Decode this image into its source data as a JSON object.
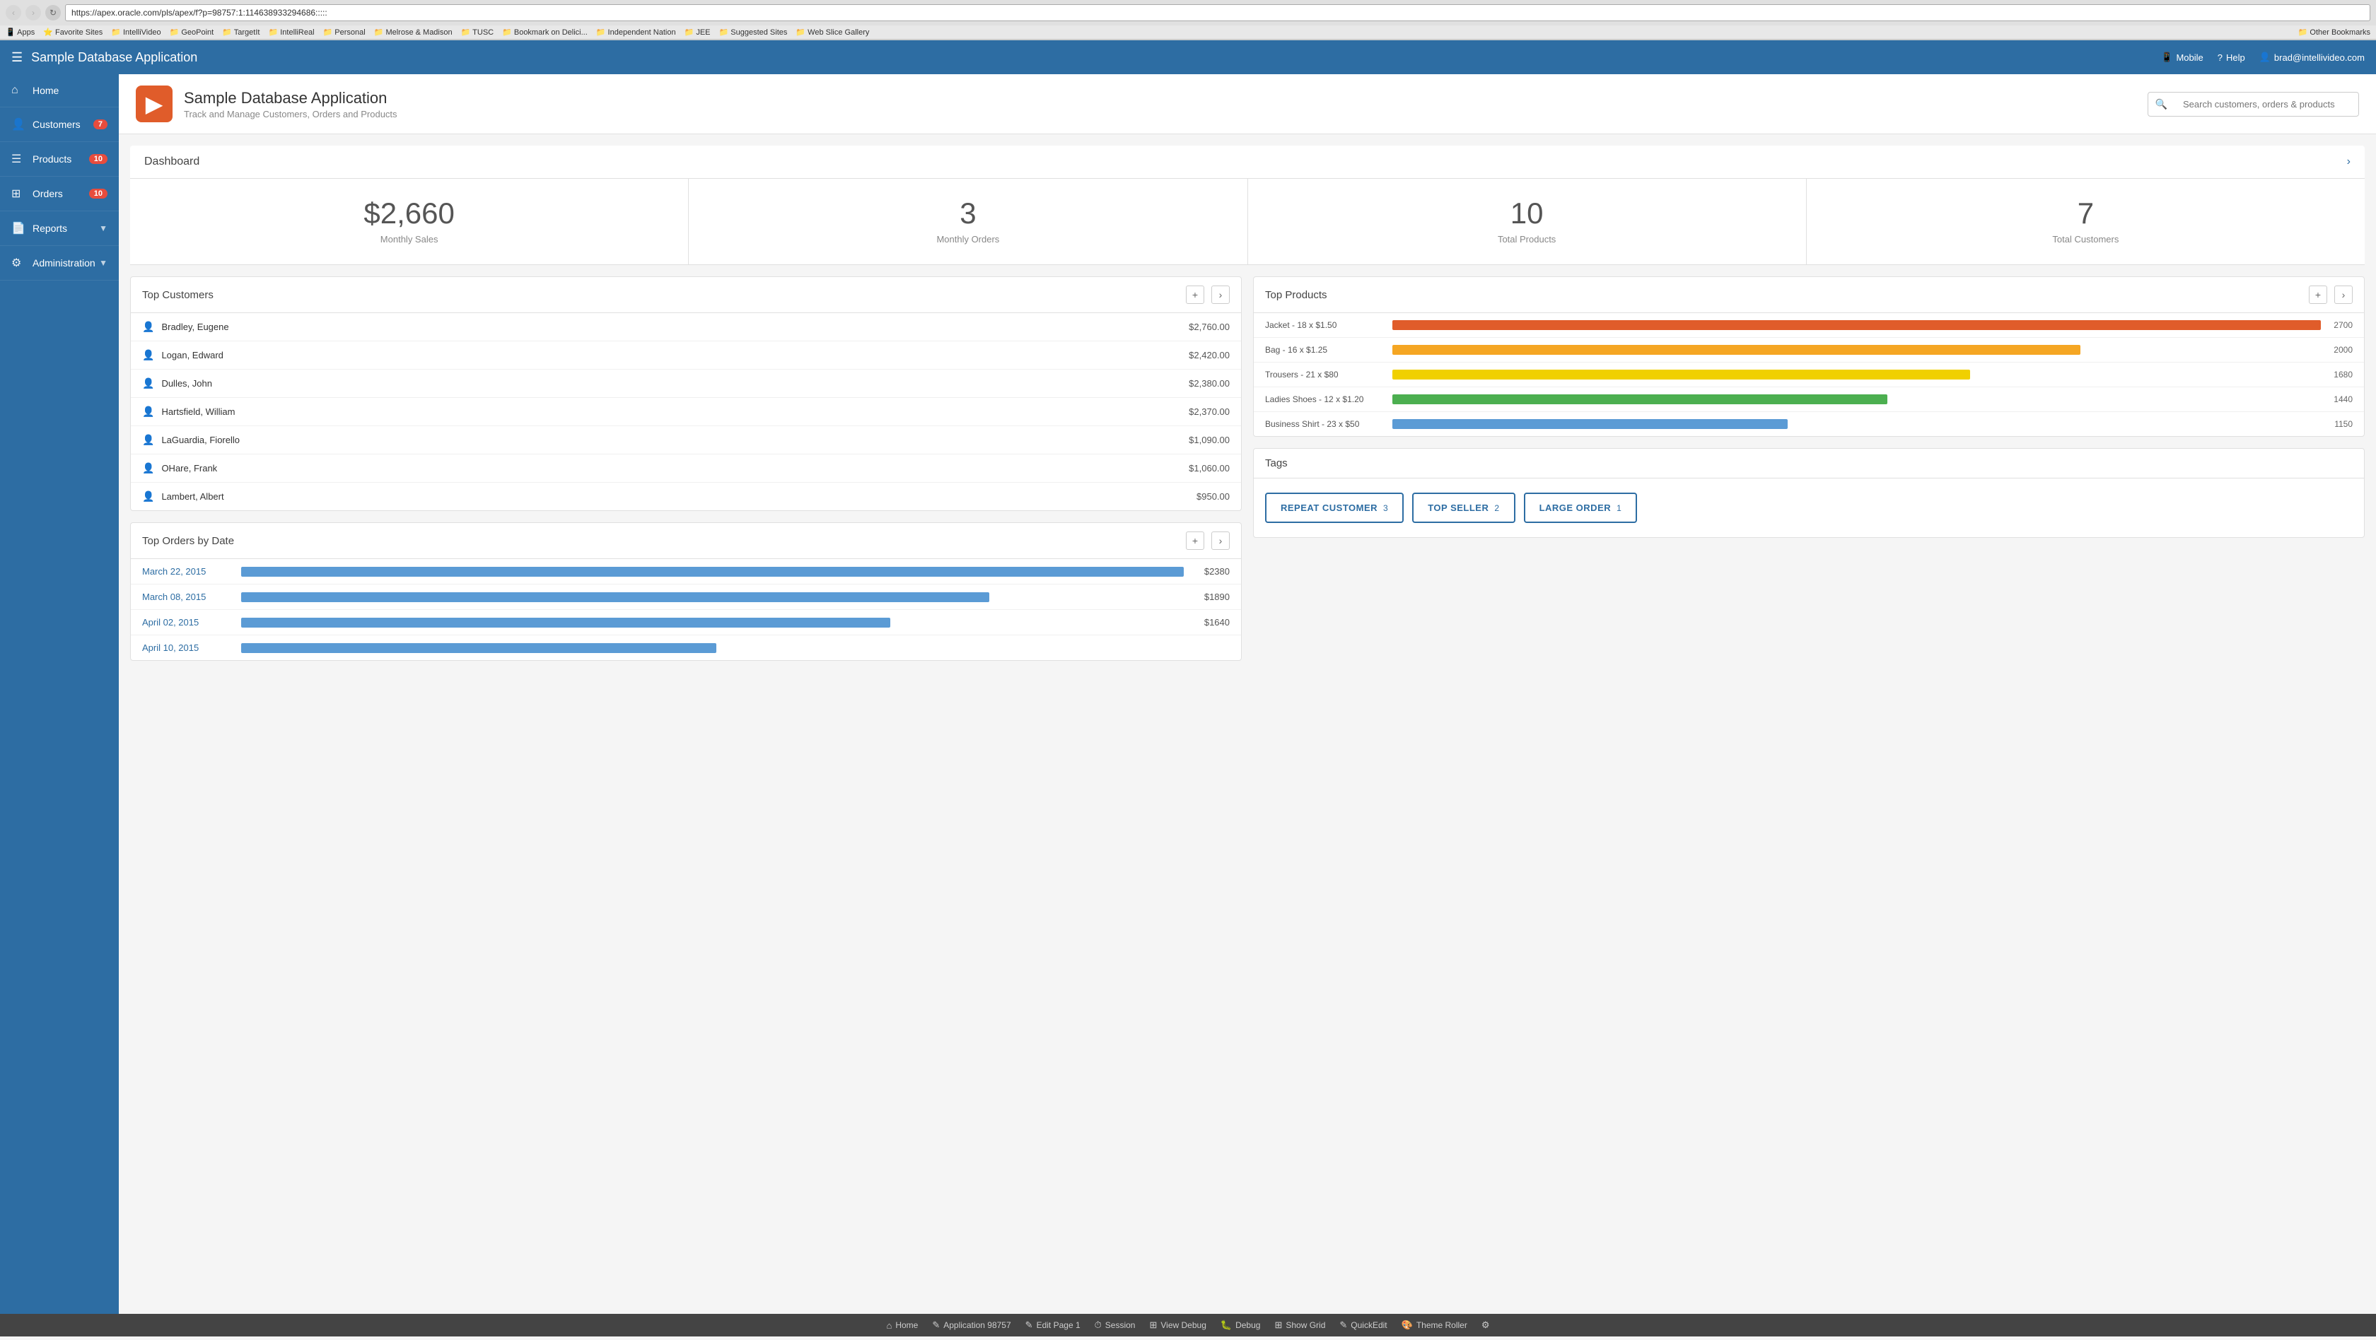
{
  "browser": {
    "url": "https://apex.oracle.com/pls/apex/f?p=98757:1:114638933294686:::::",
    "bookmarks": [
      "Apps",
      "Favorite Sites",
      "IntelliVideo",
      "GeoPoint",
      "TargetIt",
      "IntelliReal",
      "Personal",
      "Melrose & Madison",
      "TUSC",
      "Bookmark on Delici...",
      "Independent Nation",
      "JEE",
      "Suggested Sites",
      "Web Slice Gallery",
      "Other Bookmarks"
    ]
  },
  "topnav": {
    "title": "Sample Database Application",
    "mobile_label": "Mobile",
    "help_label": "Help",
    "user_label": "brad@intellivideo.com"
  },
  "sidebar": {
    "items": [
      {
        "id": "home",
        "label": "Home",
        "icon": "⌂",
        "badge": null,
        "chevron": false,
        "active": false
      },
      {
        "id": "customers",
        "label": "Customers",
        "icon": "👤",
        "badge": "7",
        "chevron": false,
        "active": false
      },
      {
        "id": "products",
        "label": "Products",
        "icon": "☰",
        "badge": "10",
        "chevron": false,
        "active": false
      },
      {
        "id": "orders",
        "label": "Orders",
        "icon": "⊞",
        "badge": "10",
        "chevron": false,
        "active": false
      },
      {
        "id": "reports",
        "label": "Reports",
        "icon": "📄",
        "badge": null,
        "chevron": true,
        "active": false
      },
      {
        "id": "administration",
        "label": "Administration",
        "icon": "⚙",
        "badge": null,
        "chevron": true,
        "active": false
      }
    ]
  },
  "app_header": {
    "title": "Sample Database Application",
    "subtitle": "Track and Manage Customers, Orders and Products",
    "search_placeholder": "Search customers, orders & products"
  },
  "dashboard": {
    "title": "Dashboard",
    "stats": [
      {
        "value": "$2,660",
        "label": "Monthly Sales"
      },
      {
        "value": "3",
        "label": "Monthly Orders"
      },
      {
        "value": "10",
        "label": "Total Products"
      },
      {
        "value": "7",
        "label": "Total Customers"
      }
    ]
  },
  "top_customers": {
    "title": "Top Customers",
    "add_label": "+",
    "nav_label": "›",
    "rows": [
      {
        "name": "Bradley, Eugene",
        "amount": "$2,760.00"
      },
      {
        "name": "Logan, Edward",
        "amount": "$2,420.00"
      },
      {
        "name": "Dulles, John",
        "amount": "$2,380.00"
      },
      {
        "name": "Hartsfield, William",
        "amount": "$2,370.00"
      },
      {
        "name": "LaGuardia, Fiorello",
        "amount": "$1,090.00"
      },
      {
        "name": "OHare, Frank",
        "amount": "$1,060.00"
      },
      {
        "name": "Lambert, Albert",
        "amount": "$950.00"
      }
    ]
  },
  "top_products": {
    "title": "Top Products",
    "add_label": "+",
    "nav_label": "›",
    "max_value": 2700,
    "rows": [
      {
        "name": "Jacket - 18 x $1.50",
        "value": 2700,
        "color": "#e05c2a"
      },
      {
        "name": "Bag - 16 x $1.25",
        "value": 2000,
        "color": "#f5a623"
      },
      {
        "name": "Trousers - 21 x $80",
        "value": 1680,
        "color": "#f0d000"
      },
      {
        "name": "Ladies Shoes - 12 x $1.20",
        "value": 1440,
        "color": "#4caf50"
      },
      {
        "name": "Business Shirt - 23 x $50",
        "value": 1150,
        "color": "#5b9bd5"
      }
    ]
  },
  "top_orders": {
    "title": "Top Orders by Date",
    "add_label": "+",
    "nav_label": "›",
    "max_value": 2380,
    "rows": [
      {
        "date": "March 22, 2015",
        "amount": "$2380",
        "value": 2380
      },
      {
        "date": "March 08, 2015",
        "amount": "$1890",
        "value": 1890
      },
      {
        "date": "April 02, 2015",
        "amount": "$1640",
        "value": 1640
      },
      {
        "date": "April 10, 2015",
        "amount": "",
        "value": 1200
      }
    ]
  },
  "tags": {
    "title": "Tags",
    "items": [
      {
        "label": "REPEAT CUSTOMER",
        "count": "3",
        "color": "#2d6da3"
      },
      {
        "label": "TOP SELLER",
        "count": "2",
        "color": "#2d6da3"
      },
      {
        "label": "LARGE ORDER",
        "count": "1",
        "color": "#2d6da3"
      }
    ]
  },
  "bottom_toolbar": {
    "items": [
      {
        "id": "home",
        "icon": "⌂",
        "label": "Home"
      },
      {
        "id": "application",
        "icon": "✎",
        "label": "Application 98757"
      },
      {
        "id": "edit-page",
        "icon": "✎",
        "label": "Edit Page 1"
      },
      {
        "id": "session",
        "icon": "⏱",
        "label": "Session"
      },
      {
        "id": "view-debug",
        "icon": "⊞",
        "label": "View Debug"
      },
      {
        "id": "debug",
        "icon": "🐛",
        "label": "Debug"
      },
      {
        "id": "show-grid",
        "icon": "⊞",
        "label": "Show Grid"
      },
      {
        "id": "quick-edit",
        "icon": "✎",
        "label": "QuickEdit"
      },
      {
        "id": "theme-roller",
        "icon": "🎨",
        "label": "Theme Roller"
      },
      {
        "id": "settings",
        "icon": "⚙",
        "label": ""
      }
    ]
  }
}
